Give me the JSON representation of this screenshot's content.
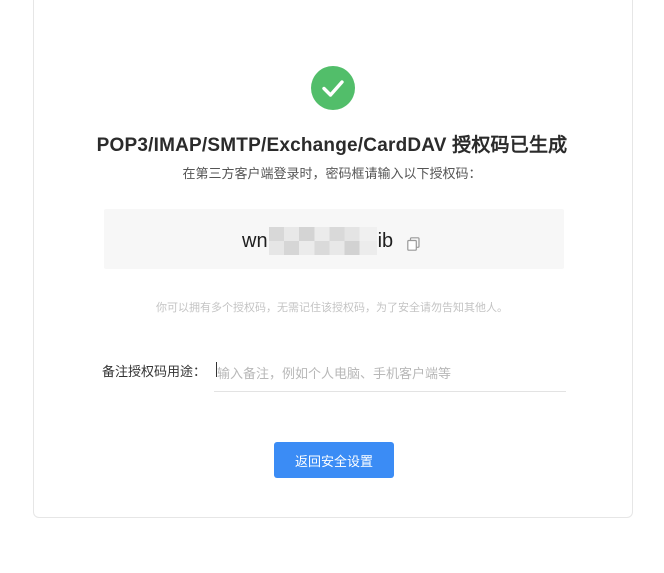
{
  "success": {
    "icon": "check-circle-icon",
    "color": "#52be6a"
  },
  "title": "POP3/IMAP/SMTP/Exchange/CardDAV 授权码已生成",
  "subtitle": "在第三方客户端登录时，密码框请输入以下授权码：",
  "auth_code": {
    "prefix": "wn",
    "suffix": "ib",
    "copy_icon": "copy-icon"
  },
  "hint": "你可以拥有多个授权码，无需记住该授权码，为了安全请勿告知其他人。",
  "note": {
    "label": "备注授权码用途：",
    "placeholder": "输入备注，例如个人电脑、手机客户端等",
    "value": ""
  },
  "actions": {
    "back_label": "返回安全设置",
    "accent": "#3b8cf5"
  }
}
